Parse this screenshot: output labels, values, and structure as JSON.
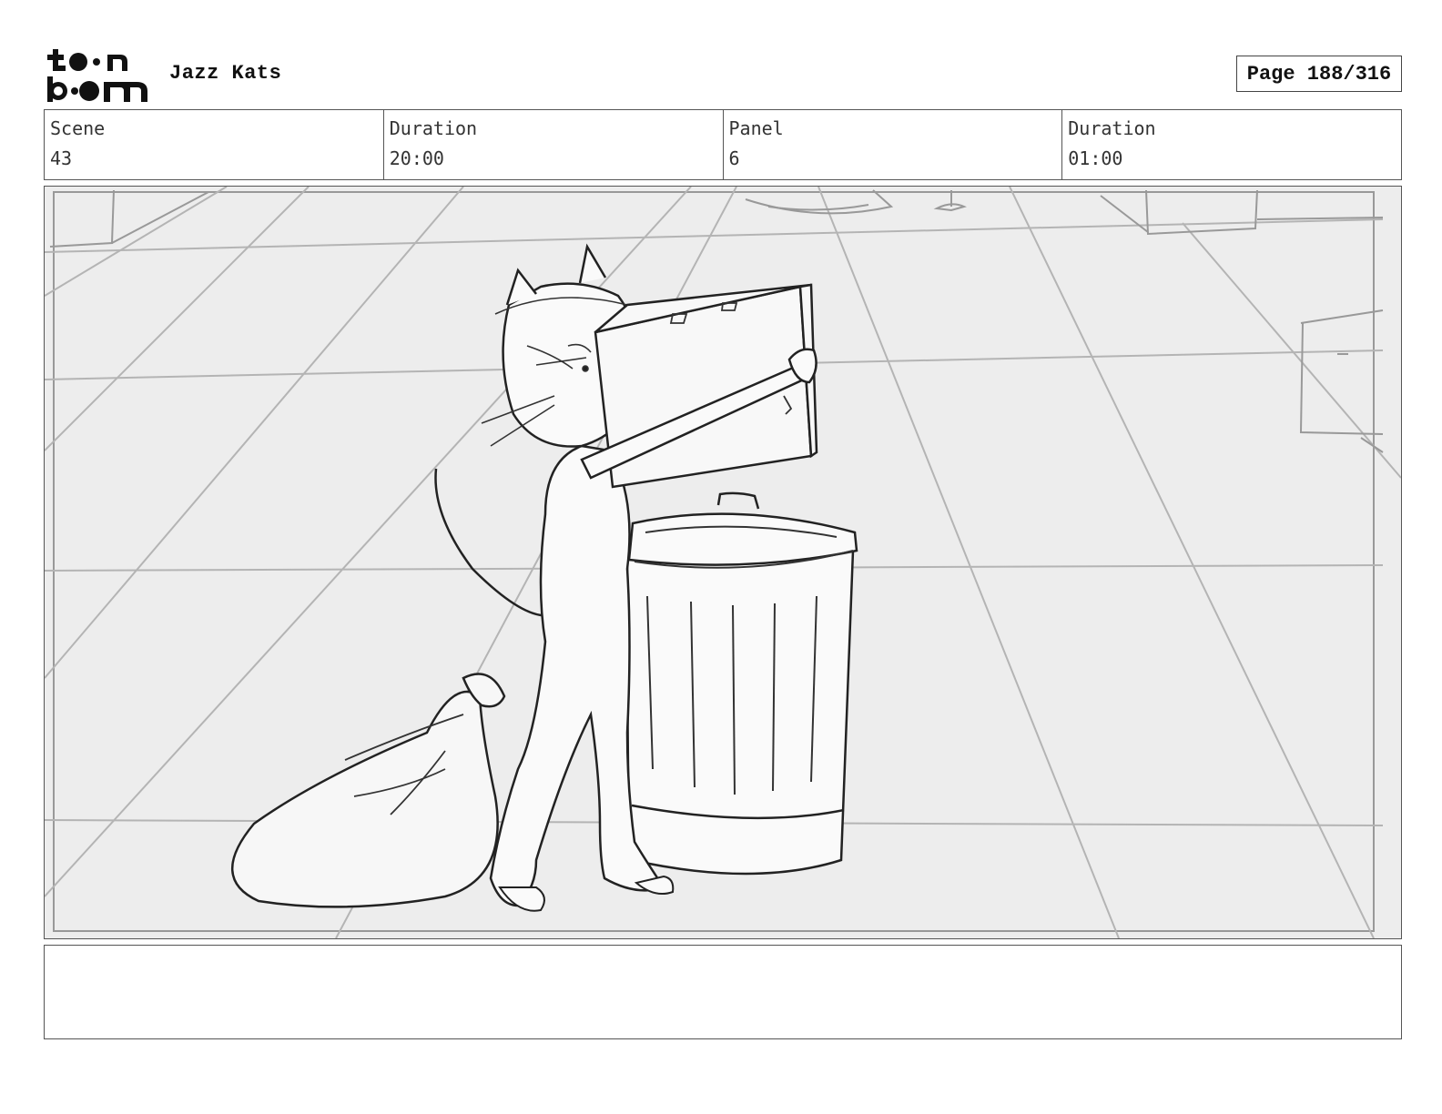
{
  "header": {
    "logo_icon": "toonboom-logo",
    "project_title": "Jazz Kats",
    "page_label": "Page 188/316"
  },
  "info": {
    "scene_label": "Scene",
    "scene_value": "43",
    "scene_duration_label": "Duration",
    "scene_duration_value": "20:00",
    "panel_label": "Panel",
    "panel_value": "6",
    "panel_duration_label": "Duration",
    "panel_duration_value": "01:00"
  },
  "panel": {
    "image_icon": "storyboard-sketch-cat-trash-can"
  },
  "notes": {
    "text": ""
  }
}
